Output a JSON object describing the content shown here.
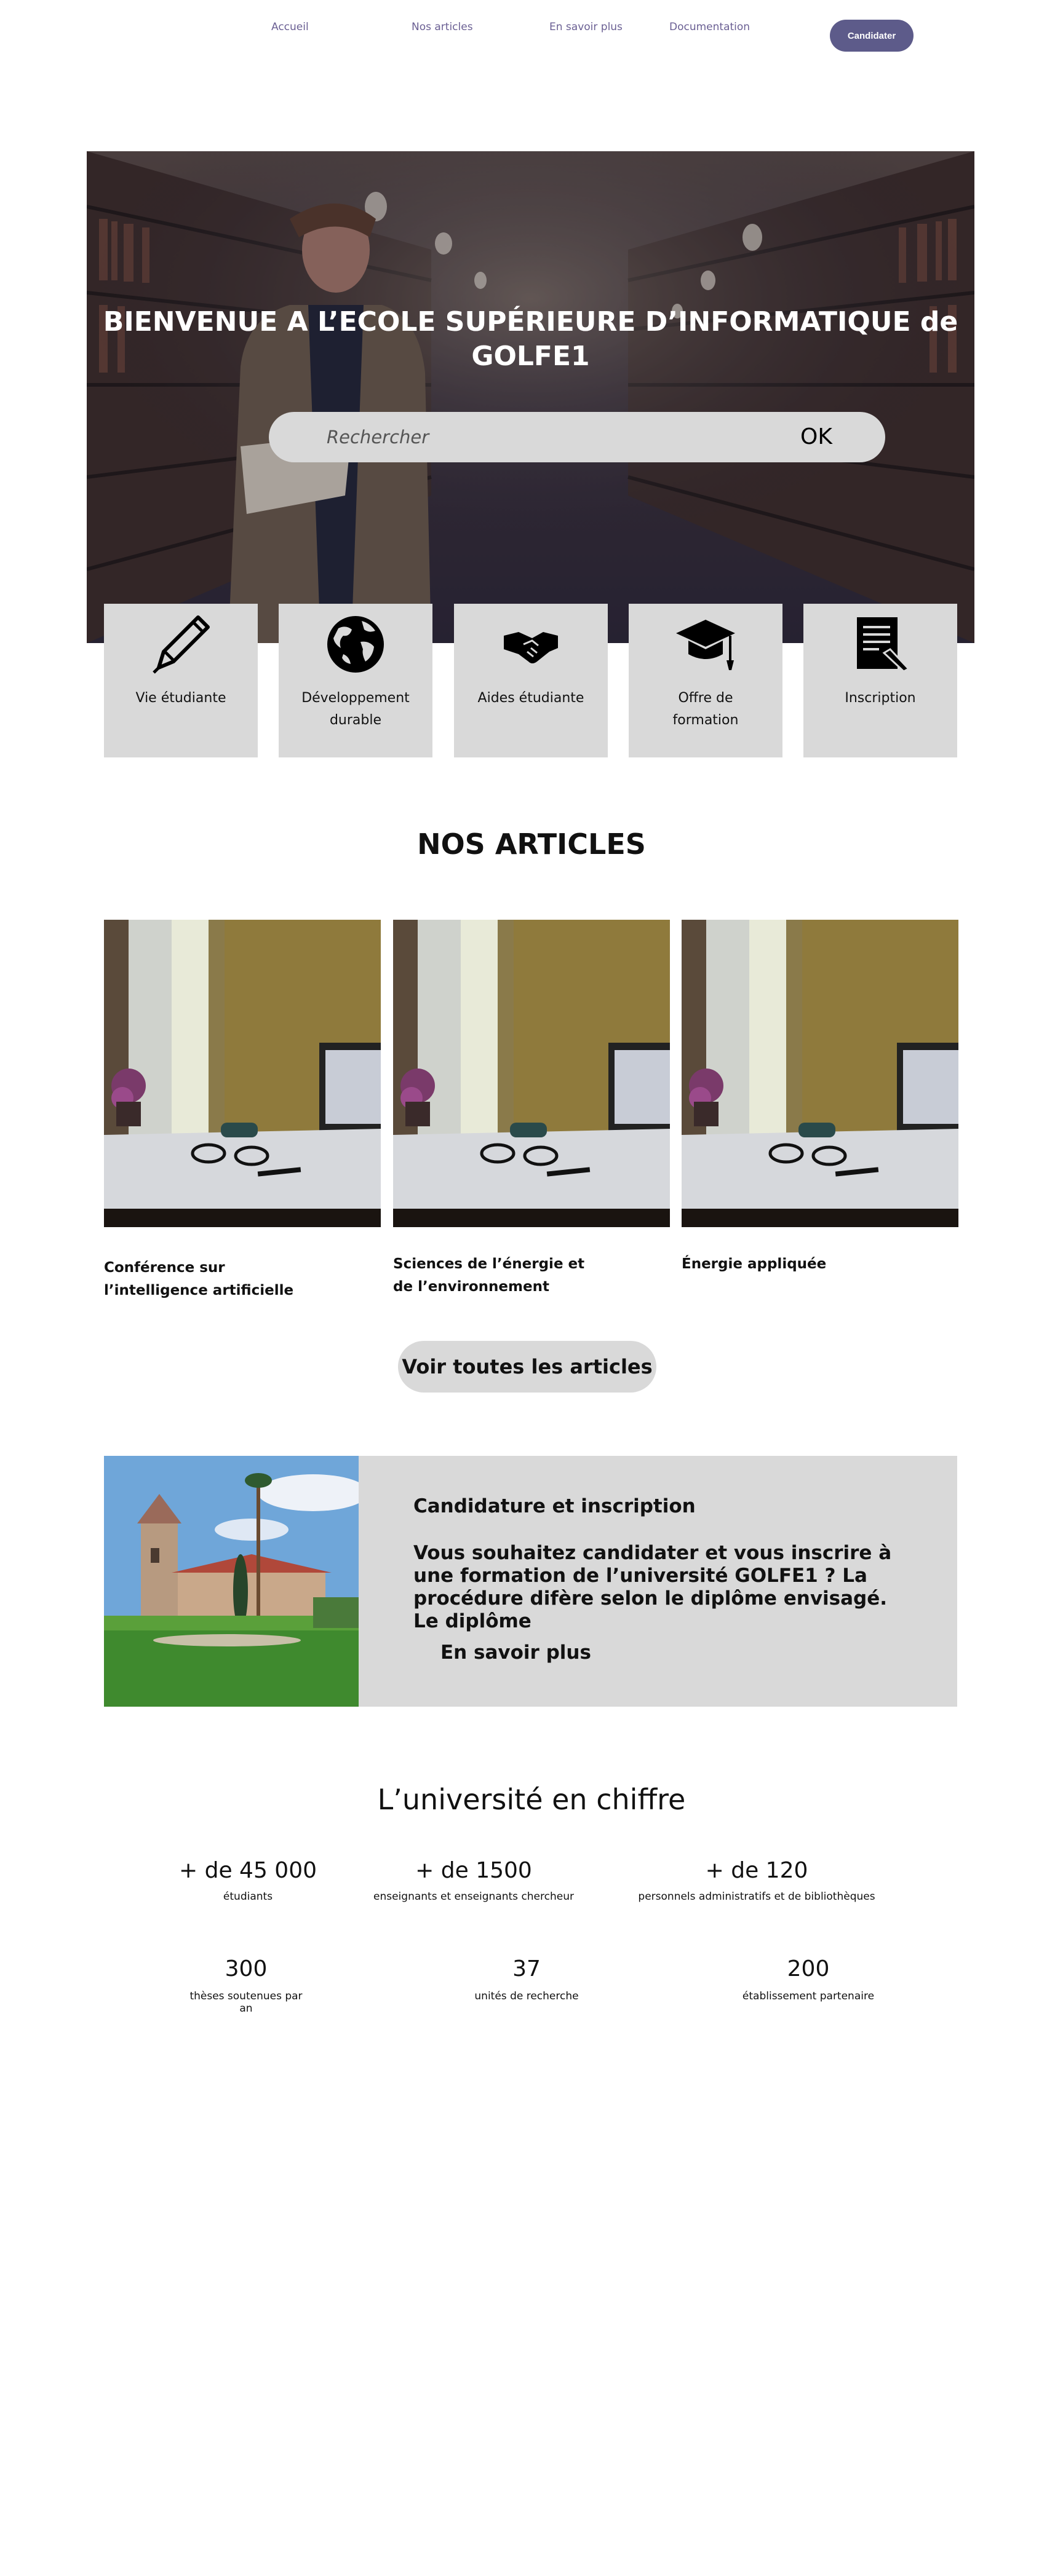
{
  "nav": {
    "items": [
      "Accueil",
      "Nos articles",
      "En savoir plus",
      "Documentation"
    ],
    "cta_label": "Candidater"
  },
  "hero": {
    "title_line1": "BIENVENUE A L’ECOLE SUPÉRIEURE  D’INFORMATIQUE de",
    "title_line2": "GOLFE1",
    "search_placeholder": "Rechercher",
    "search_button": "OK"
  },
  "quick_links": [
    {
      "label": "Vie étudiante",
      "icon": "pen-icon"
    },
    {
      "label": "Développement durable",
      "icon": "globe-icon"
    },
    {
      "label": "Aides étudiante",
      "icon": "handshake-icon"
    },
    {
      "label": "Offre de formation",
      "icon": "graduation-cap-icon"
    },
    {
      "label": "Inscription",
      "icon": "document-edit-icon"
    }
  ],
  "articles": {
    "heading": "NOS ARTICLES",
    "items": [
      {
        "title": "Conférence sur l’intelligence artificielle"
      },
      {
        "title": "Sciences de l’énergie et de l’environnement"
      },
      {
        "title": "Énergie appliquée"
      }
    ],
    "view_all_label": "Voir toutes les articles"
  },
  "candidature": {
    "title": "Candidature et inscription",
    "text": "Vous souhaitez candidater et vous inscrire à une formation de l’université  GOLFE1 ? La procédure difère selon le diplôme envisagé. Le diplôme",
    "link_label": "En savoir plus"
  },
  "stats": {
    "heading": "L’université en chiffre",
    "items": [
      {
        "value": "+ de 45 000",
        "label": "étudiants"
      },
      {
        "value": "+ de 1500",
        "label": "enseignants et enseignants chercheur"
      },
      {
        "value": "+ de 120",
        "label": "personnels administratifs et de bibliothèques"
      },
      {
        "value": "300",
        "label": "thèses soutenues par an"
      },
      {
        "value": "37",
        "label": "unités de recherche"
      },
      {
        "value": "200",
        "label": "établissement partenaire"
      }
    ]
  },
  "colors": {
    "accent": "#5d5b8a",
    "nav_link": "#6a5f93",
    "card_bg": "#d9d9d9"
  }
}
